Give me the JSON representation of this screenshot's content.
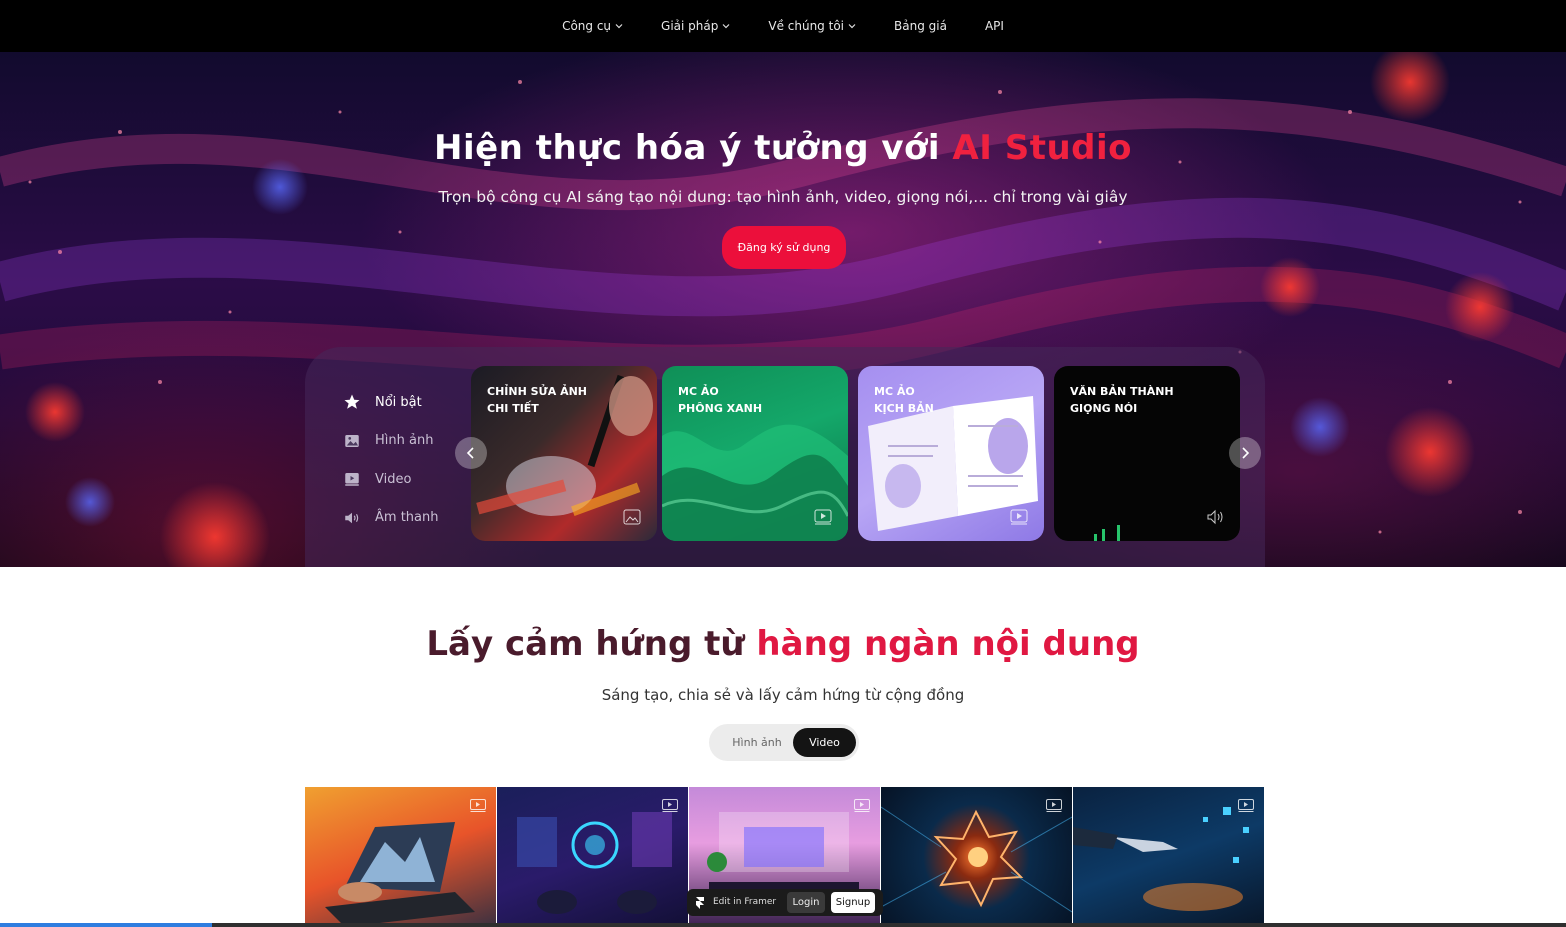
{
  "nav": {
    "items": [
      "Công cụ",
      "Giải pháp",
      "Về chúng tôi",
      "Bảng giá",
      "API"
    ]
  },
  "hero": {
    "title_main": "Hiện thực hóa ý tưởng với ",
    "title_accent": "AI Studio",
    "subtitle": "Trọn bộ công cụ AI sáng tạo nội dung: tạo hình ảnh, video, giọng nói,... chỉ trong vài giây",
    "cta": "Đăng ký sử dụng"
  },
  "categories": [
    "Nổi bật",
    "Hình ảnh",
    "Video",
    "Âm thanh"
  ],
  "cards": [
    {
      "line1": "CHỈNH SỬA ẢNH",
      "line2": "CHI TIẾT",
      "icon": "image-icon"
    },
    {
      "line1": "MC ẢO",
      "line2": "PHÔNG XANH",
      "icon": "video-icon"
    },
    {
      "line1": "MC ẢO",
      "line2": "KỊCH BẢN",
      "icon": "video-icon"
    },
    {
      "line1": "VĂN BẢN THÀNH",
      "line2": "GIỌNG NÓI",
      "icon": "speaker-icon"
    }
  ],
  "inspiration": {
    "title_dark": "Lấy cảm hứng từ ",
    "title_red": "hàng ngàn nội dung",
    "subtitle": "Sáng tạo, chia sẻ và lấy cảm hứng từ cộng đồng",
    "toggle_off": "Hình ảnh",
    "toggle_on": "Video"
  },
  "framer": {
    "edit": "Edit in Framer",
    "login": "Login",
    "signup": "Signup"
  },
  "colors": {
    "accent": "#ec0f3b",
    "nav_bg": "#000000"
  }
}
